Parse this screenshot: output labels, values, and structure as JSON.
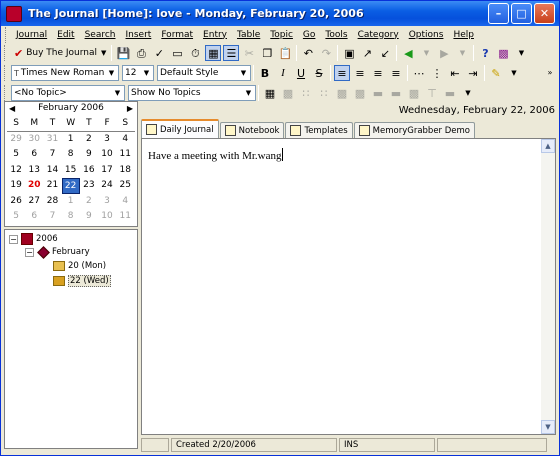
{
  "window": {
    "title": "The Journal [Home]: love - Monday, February 20, 2006"
  },
  "menu": [
    "Journal",
    "Edit",
    "Search",
    "Insert",
    "Format",
    "Entry",
    "Table",
    "Topic",
    "Go",
    "Tools",
    "Category",
    "Options",
    "Help"
  ],
  "toolbar1": {
    "buy_label": "Buy The Journal"
  },
  "toolbar2": {
    "font": "Times New Roman",
    "size": "12",
    "style": "Default Style"
  },
  "toolbar3": {
    "topic": "<No Topic>",
    "show_topics": "Show No Topics"
  },
  "calendar": {
    "month": "February 2006",
    "dow": [
      "S",
      "M",
      "T",
      "W",
      "T",
      "F",
      "S"
    ],
    "weeks": [
      [
        "29",
        "30",
        "31",
        "1",
        "2",
        "3",
        "4"
      ],
      [
        "5",
        "6",
        "7",
        "8",
        "9",
        "10",
        "11"
      ],
      [
        "12",
        "13",
        "14",
        "15",
        "16",
        "17",
        "18"
      ],
      [
        "19",
        "20",
        "21",
        "22",
        "23",
        "24",
        "25"
      ],
      [
        "26",
        "27",
        "28",
        "1",
        "2",
        "3",
        "4"
      ],
      [
        "5",
        "6",
        "7",
        "8",
        "9",
        "10",
        "11"
      ]
    ]
  },
  "tree": {
    "year": "2006",
    "month": "February",
    "entries": [
      "20 (Mon)",
      "22 (Wed)"
    ]
  },
  "date_banner": "Wednesday, February 22, 2006",
  "tabs": [
    "Daily Journal",
    "Notebook",
    "Templates",
    "MemoryGrabber Demo"
  ],
  "editor": {
    "text": "Have a meeting with Mr.wang"
  },
  "status": {
    "created": "Created 2/20/2006",
    "mode": "INS"
  },
  "colors": {
    "title_bar": "#0a5ee4",
    "selected_day": "#316ac5",
    "highlight_day": "#e00000",
    "active_tab_accent": "#e68b2c"
  }
}
